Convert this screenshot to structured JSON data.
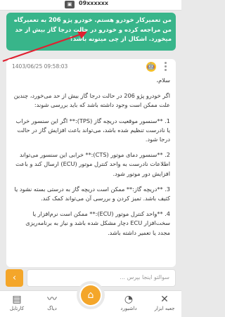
{
  "status": {
    "user_id": "09xxxxxx"
  },
  "user_message": "من تعمیرکار خودرو هستم. خودرو پژو 206 به تعمیرگاه من مراجعه کرده و خودرو در حالت درجا گاز بیش از حد میخورد. اشکال از چی میتونه باشد؟",
  "bot": {
    "timestamp": "1403/06/25 09:58:03",
    "paragraphs": [
      "سلام،",
      "اگر خودرو پژو 206 در حالت درجا گاز بیش از حد می‌خورد، چندین علت ممکن است وجود داشته باشد که باید بررسی شوند:",
      "1. **سنسور موقعیت دریچه گاز (TPS):** اگر این سنسور خراب یا نادرست تنظیم شده باشد، می‌تواند باعث افزایش گاز در حالت درجا شود.",
      "2. **سنسور دمای موتور (CTS):** خرابی این سنسور می‌تواند اطلاعات نادرست به واحد کنترل موتور (ECU) ارسال کند و باعث افزایش دور موتور شود.",
      "3. **دریچه گاز:** ممکن است دریچه گاز به درستی بسته نشود یا کثیف باشد. تمیز کردن و بررسی آن می‌تواند کمک کند.",
      "4. **واحد کنترل موتور (ECU):** ممکن است نرم‌افزار یا سخت‌افزار ECU دچار مشکل شده باشد و نیاز به برنامه‌ریزی مجدد یا تعمیر داشته باشد."
    ]
  },
  "composer": {
    "placeholder": "سوالتو اینجا بپرس ..."
  },
  "nav": {
    "items": [
      {
        "label": "کارتابل",
        "icon": "document-icon"
      },
      {
        "label": "دیاگ",
        "icon": "diagnostics-icon"
      },
      {
        "label": "",
        "icon": "home-icon"
      },
      {
        "label": "داشبورد",
        "icon": "speedometer-icon"
      },
      {
        "label": "جعبه ابزار",
        "icon": "tools-icon"
      }
    ]
  }
}
